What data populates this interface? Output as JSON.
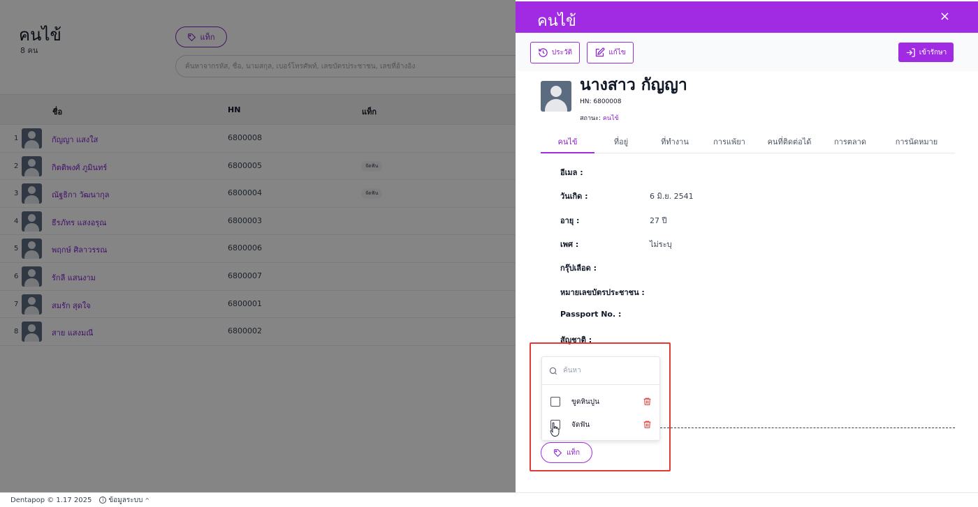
{
  "background": {
    "title": "คนไข้",
    "count": "8 คน",
    "tag_button_label": "แท็ก",
    "search_placeholder": "ค้นหาจากรหัส, ชื่อ, นามสกุล, เบอร์โทรศัพท์, เลขบัตรประชาชน, เลขที่อ้างอิง",
    "columns": {
      "name": "ชื่อ",
      "hn": "HN",
      "tag": "แท็ก"
    },
    "rows": [
      {
        "num": "1",
        "name": "กัญญา แสงใส",
        "hn": "6800008",
        "tag": ""
      },
      {
        "num": "2",
        "name": "กิตติพงศ์ ภูมินทร์",
        "hn": "6800005",
        "tag": "จัดฟัน"
      },
      {
        "num": "3",
        "name": "ณัฐธิกา วัฒนากุล",
        "hn": "6800004",
        "tag": "จัดฟัน"
      },
      {
        "num": "4",
        "name": "ธีรภัทร แสงอรุณ",
        "hn": "6800003",
        "tag": ""
      },
      {
        "num": "5",
        "name": "พฤกษ์ ศิลาวรรณ",
        "hn": "6800006",
        "tag": ""
      },
      {
        "num": "6",
        "name": "รักลี แสนงาม",
        "hn": "6800007",
        "tag": ""
      },
      {
        "num": "7",
        "name": "สมรัก สุดใจ",
        "hn": "6800001",
        "tag": ""
      },
      {
        "num": "8",
        "name": "สาย แสงมณี",
        "hn": "6800002",
        "tag": ""
      }
    ]
  },
  "footer": {
    "brand": "Dentapop © 1.17 2025",
    "info_label": "ข้อมูลระบบ",
    "info_caret": "^"
  },
  "drawer": {
    "title": "คนไข้",
    "close_icon": "×",
    "toolbar": {
      "history_label": "ประวัติ",
      "edit_label": "แก้ไข",
      "treat_label": "เข้ารักษา"
    },
    "patient": {
      "name": "นางสาว กัญญา",
      "hn": "HN: 6800008",
      "status_label": "สถานะ:",
      "status_value": "คนไข้"
    },
    "tabs": [
      "คนไข้",
      "ที่อยู่",
      "ที่ทำงาน",
      "การแพ้ยา",
      "คนที่ติดต่อได้",
      "การตลาด",
      "การนัดหมาย"
    ],
    "active_tab": "คนไข้",
    "fields": [
      {
        "label": "อีเมล :",
        "value": ""
      },
      {
        "label": "วันเกิด :",
        "value": "6 มิ.ย. 2541"
      },
      {
        "label": "อายุ :",
        "value": "27 ปี"
      },
      {
        "label": "เพศ :",
        "value": "ไม่ระบุ"
      },
      {
        "label": "กรุ๊ปเลือด :",
        "value": ""
      },
      {
        "label": "หมายเลขบัตรประชาชน :",
        "value": ""
      },
      {
        "label": "Passport No. :",
        "value": ""
      },
      {
        "label": "สัญชาติ :",
        "value": ""
      }
    ],
    "tag_popover": {
      "search_placeholder": "ค้นหา",
      "options": [
        {
          "label": "ขูดหินปูน",
          "checked": false
        },
        {
          "label": "จัดฟัน",
          "checked": false
        }
      ]
    },
    "tag_button_label": "แท็ก"
  },
  "colors": {
    "accent": "#a02be2",
    "link": "#8b22c9",
    "highlight": "#e53935",
    "danger": "#e53935"
  }
}
